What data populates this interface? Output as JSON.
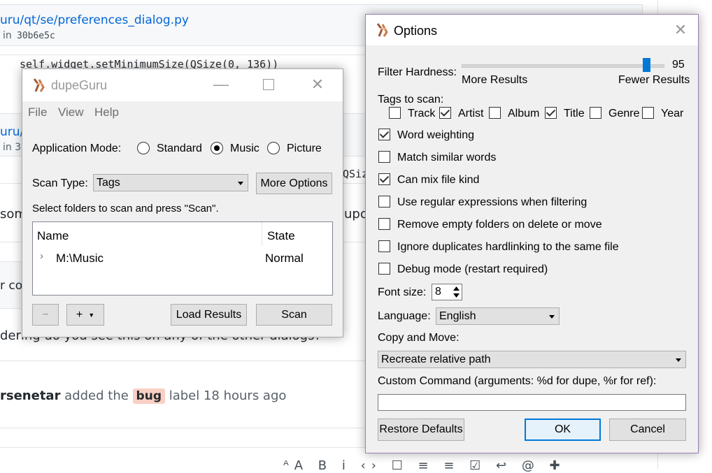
{
  "background": {
    "file_link": "uru/qt/se/preferences_dialog.py",
    "commit_prefix": "in",
    "commit_hash": "30b6e5c",
    "code_line": "self.widget.setMinimumSize(QSize(0, 136))",
    "file_link2": "uru/",
    "commit_prefix2": "in 3",
    "code_fragment": "QSiz",
    "text_left1": "som",
    "text_right1": "upc",
    "text_left2": "r co",
    "comment_text": "dering do you see this on any of the other dialogs?",
    "event_user": "rsenetar",
    "event_action": " added the ",
    "event_label": "bug",
    "event_suffix": " label 18 hours ago"
  },
  "main_window": {
    "title": "dupeGuru",
    "menu": [
      "File",
      "View",
      "Help"
    ],
    "app_mode_label": "Application Mode:",
    "modes": [
      {
        "label": "Standard",
        "selected": false
      },
      {
        "label": "Music",
        "selected": true
      },
      {
        "label": "Picture",
        "selected": false
      }
    ],
    "scan_type_label": "Scan Type:",
    "scan_type_value": "Tags",
    "more_options_label": "More Options",
    "instruction": "Select folders to scan and press \"Scan\".",
    "columns": [
      "Name",
      "State"
    ],
    "folders": [
      {
        "name": "M:\\Music",
        "state": "Normal"
      }
    ],
    "remove_label": "−",
    "add_label": "+",
    "load_results_label": "Load Results",
    "scan_label": "Scan"
  },
  "options_dialog": {
    "title": "Options",
    "filter_hardness_label": "Filter Hardness:",
    "filter_hardness_value": "95",
    "filter_hardness_level": 95,
    "more_results_label": "More Results",
    "fewer_results_label": "Fewer Results",
    "tags_label": "Tags to scan:",
    "tags": [
      {
        "label": "Track",
        "checked": false
      },
      {
        "label": "Artist",
        "checked": true
      },
      {
        "label": "Album",
        "checked": false
      },
      {
        "label": "Title",
        "checked": true
      },
      {
        "label": "Genre",
        "checked": false
      },
      {
        "label": "Year",
        "checked": false
      }
    ],
    "checks": [
      {
        "label": "Word weighting",
        "checked": true
      },
      {
        "label": "Match similar words",
        "checked": false
      },
      {
        "label": "Can mix file kind",
        "checked": true
      },
      {
        "label": "Use regular expressions when filtering",
        "checked": false
      },
      {
        "label": "Remove empty folders on delete or move",
        "checked": false
      },
      {
        "label": "Ignore duplicates hardlinking to the same file",
        "checked": false
      },
      {
        "label": "Debug mode (restart required)",
        "checked": false
      }
    ],
    "font_size_label": "Font size:",
    "font_size_value": "8",
    "language_label": "Language:",
    "language_value": "English",
    "copy_move_label": "Copy and Move:",
    "copy_move_value": "Recreate relative path",
    "custom_command_label": "Custom Command (arguments: %d for dupe, %r for ref):",
    "custom_command_value": "",
    "restore_defaults_label": "Restore Defaults",
    "ok_label": "OK",
    "cancel_label": "Cancel"
  }
}
